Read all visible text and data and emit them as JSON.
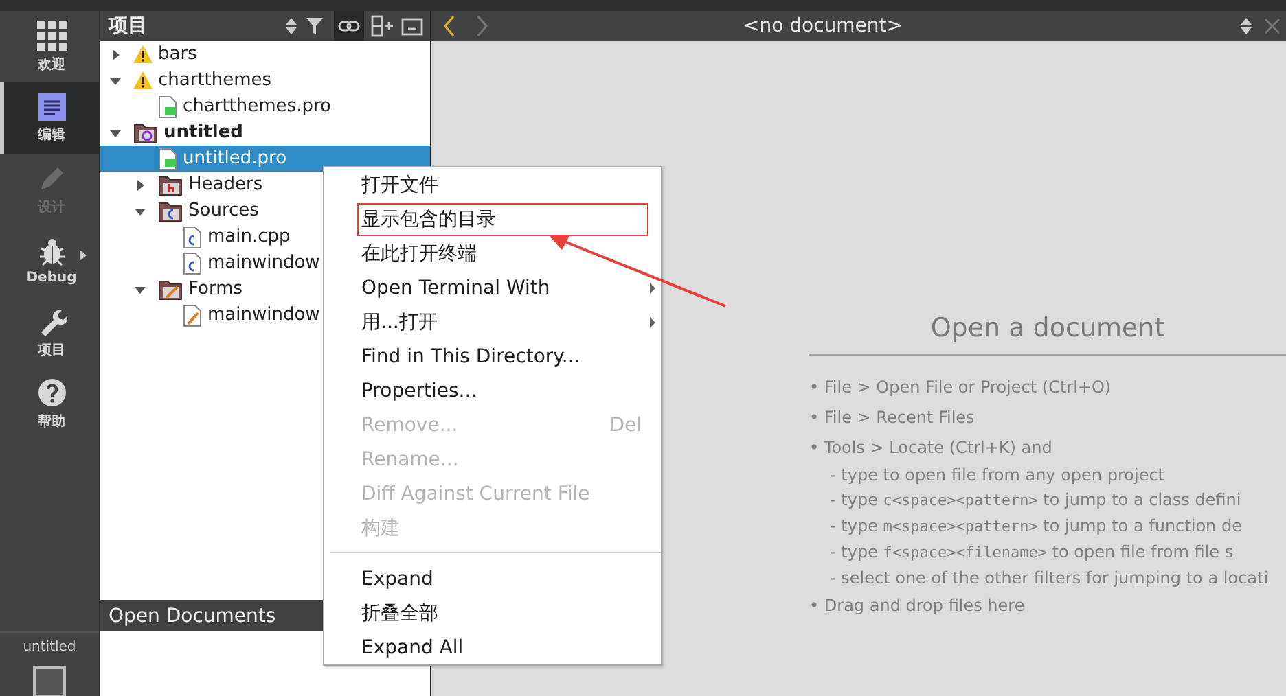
{
  "modes": [
    {
      "label": "欢迎",
      "selected": false,
      "disabled": false,
      "submenu": false
    },
    {
      "label": "编辑",
      "selected": true,
      "disabled": false,
      "submenu": false
    },
    {
      "label": "设计",
      "selected": false,
      "disabled": true,
      "submenu": false
    },
    {
      "label": "Debug",
      "selected": false,
      "disabled": false,
      "submenu": true
    },
    {
      "label": "项目",
      "selected": false,
      "disabled": false,
      "submenu": false
    },
    {
      "label": "帮助",
      "selected": false,
      "disabled": false,
      "submenu": false
    }
  ],
  "kit": {
    "label": "untitled"
  },
  "projects_panel": {
    "title": "项目"
  },
  "tree": [
    {
      "label": "bars",
      "kind": "warning",
      "expanded": false,
      "active": false,
      "selected": false
    },
    {
      "label": "chartthemes",
      "kind": "warning",
      "expanded": true,
      "active": false,
      "selected": false,
      "children": [
        {
          "label": "chartthemes.pro",
          "kind": "pro",
          "selected": false
        }
      ]
    },
    {
      "label": "untitled",
      "kind": "project",
      "expanded": true,
      "active": true,
      "selected": false,
      "children": [
        {
          "label": "untitled.pro",
          "kind": "pro",
          "selected": true
        },
        {
          "label": "Headers",
          "kind": "folder-h",
          "expanded": false,
          "selected": false
        },
        {
          "label": "Sources",
          "kind": "folder-cpp",
          "expanded": true,
          "selected": false,
          "children": [
            {
              "label": "main.cpp",
              "kind": "cpp",
              "selected": false
            },
            {
              "label": "mainwindow",
              "kind": "cpp",
              "selected": false
            }
          ]
        },
        {
          "label": "Forms",
          "kind": "folder-ui",
          "expanded": true,
          "selected": false,
          "children": [
            {
              "label": "mainwindow",
              "kind": "ui",
              "selected": false
            }
          ]
        }
      ]
    }
  ],
  "open_documents": {
    "title": "Open Documents"
  },
  "editor": {
    "document": "<no document>",
    "heading": "Open a document",
    "hints": [
      {
        "kind": "bullet",
        "marker": "•",
        "parts": [
          {
            "text": "File > Open File or Project (Ctrl+O)",
            "mono": false
          }
        ]
      },
      {
        "kind": "bullet",
        "marker": "•",
        "parts": [
          {
            "text": "File > Recent Files",
            "mono": false
          }
        ]
      },
      {
        "kind": "bullet",
        "marker": "•",
        "parts": [
          {
            "text": "Tools > Locate (Ctrl+K) and",
            "mono": false
          }
        ]
      },
      {
        "kind": "sub",
        "parts": [
          {
            "text": "- type to open file from any open project",
            "mono": false
          }
        ]
      },
      {
        "kind": "sub",
        "parts": [
          {
            "text": "- type ",
            "mono": false
          },
          {
            "text": "c<space><pattern>",
            "mono": true
          },
          {
            "text": " to jump to a class defini",
            "mono": false
          }
        ]
      },
      {
        "kind": "sub",
        "parts": [
          {
            "text": "- type ",
            "mono": false
          },
          {
            "text": "m<space><pattern>",
            "mono": true
          },
          {
            "text": " to jump to a function de",
            "mono": false
          }
        ]
      },
      {
        "kind": "sub",
        "parts": [
          {
            "text": "- type ",
            "mono": false
          },
          {
            "text": "f<space><filename>",
            "mono": true
          },
          {
            "text": " to open file from file s",
            "mono": false
          }
        ]
      },
      {
        "kind": "sub",
        "parts": [
          {
            "text": "- select one of the other filters for jumping to a locati",
            "mono": false
          }
        ]
      },
      {
        "kind": "bullet",
        "marker": "•",
        "parts": [
          {
            "text": "Drag and drop files here",
            "mono": false
          }
        ]
      }
    ]
  },
  "context_menu": [
    {
      "kind": "item",
      "label": "打开文件",
      "disabled": false,
      "submenu": false,
      "annotated": false
    },
    {
      "kind": "item",
      "label": "显示包含的目录",
      "disabled": false,
      "submenu": false,
      "annotated": true
    },
    {
      "kind": "item",
      "label": "在此打开终端",
      "disabled": false,
      "submenu": false,
      "annotated": false
    },
    {
      "kind": "item",
      "label": "Open Terminal With",
      "disabled": false,
      "submenu": true,
      "annotated": false
    },
    {
      "kind": "item",
      "label": "用...打开",
      "disabled": false,
      "submenu": true,
      "annotated": false
    },
    {
      "kind": "item",
      "label": "Find in This Directory...",
      "disabled": false,
      "submenu": false,
      "annotated": false
    },
    {
      "kind": "item",
      "label": "Properties...",
      "disabled": false,
      "submenu": false,
      "annotated": false
    },
    {
      "kind": "item",
      "label": "Remove...",
      "shortcut": "Del",
      "disabled": true,
      "submenu": false,
      "annotated": false
    },
    {
      "kind": "item",
      "label": "Rename...",
      "disabled": true,
      "submenu": false,
      "annotated": false
    },
    {
      "kind": "item",
      "label": "Diff Against Current File",
      "disabled": true,
      "submenu": false,
      "annotated": false
    },
    {
      "kind": "item",
      "label": "构建",
      "disabled": true,
      "submenu": false,
      "annotated": false
    },
    {
      "kind": "separator"
    },
    {
      "kind": "item",
      "label": "Expand",
      "disabled": false,
      "submenu": false,
      "annotated": false
    },
    {
      "kind": "item",
      "label": "折叠全部",
      "disabled": false,
      "submenu": false,
      "annotated": false
    },
    {
      "kind": "item",
      "label": "Expand All",
      "disabled": false,
      "submenu": false,
      "annotated": false
    }
  ]
}
